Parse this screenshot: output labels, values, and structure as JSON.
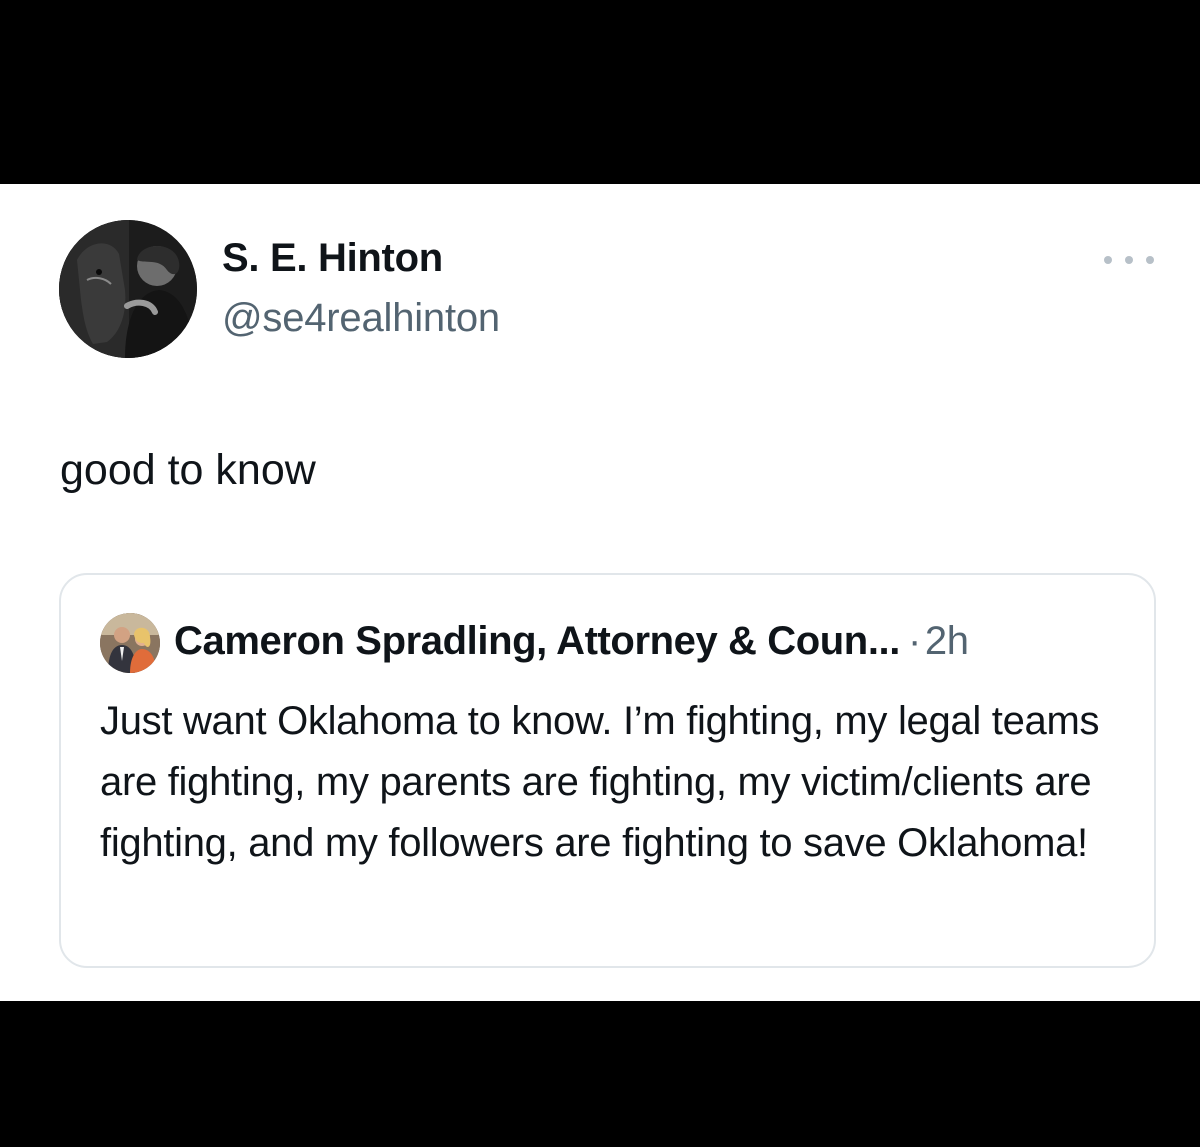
{
  "tweet": {
    "author_name": "S. E. Hinton",
    "author_handle": "@se4realhinton",
    "text": "good to know",
    "avatar_icon": "profile-photo-woman-with-horse",
    "more_icon": "more-options-icon"
  },
  "quoted_tweet": {
    "author_name": "Cameron Spradling, Attorney & Coun...",
    "separator": "·",
    "time": "2h",
    "text": "Just want Oklahoma to know.  I’m fighting, my legal teams are fighting, my parents are fighting, my victim/clients are fighting, and my followers are fighting to save Oklahoma!",
    "avatar_icon": "profile-photo-couple"
  },
  "colors": {
    "background": "#000000",
    "panel": "#ffffff",
    "primary_text": "#0f1419",
    "secondary_text": "#536471",
    "card_border": "#e1e6ea"
  }
}
